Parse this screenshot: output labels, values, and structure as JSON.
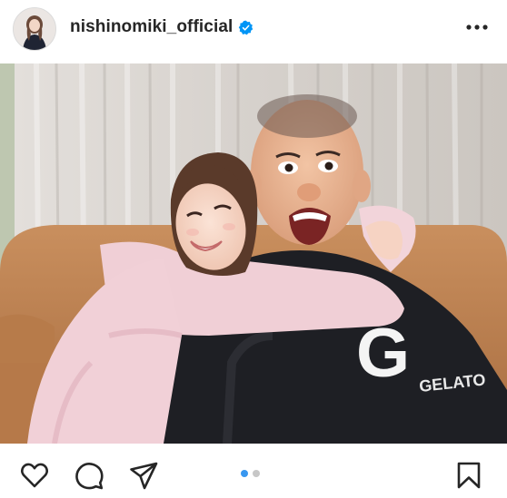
{
  "header": {
    "username": "nishinomiki_official",
    "verified": true,
    "avatar_icon": "profile-avatar",
    "more_icon": "more-options-icon"
  },
  "photo": {
    "icon": "photo-two-people-hugging-on-sofa",
    "sweater_text": "G",
    "sweater_small_text": "GELATO"
  },
  "actions": {
    "icons": [
      "heart-icon",
      "comment-icon",
      "share-icon",
      "bookmark-icon"
    ],
    "carousel": {
      "count": 2,
      "active_index": 0
    }
  },
  "colors": {
    "text": "#262626",
    "verified_blue": "#0095f6",
    "active_dot": "#3897f0",
    "inactive_dot": "#c7c7c7"
  }
}
